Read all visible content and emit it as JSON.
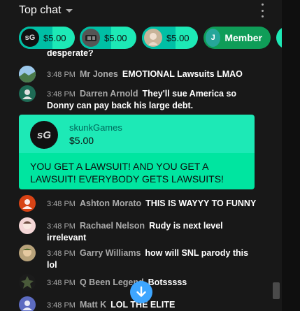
{
  "header": {
    "title": "Top chat"
  },
  "tickers": [
    {
      "amount": "$5.00",
      "avatar_text": "sG",
      "avatar_bg": "#111111",
      "fill": 0.6
    },
    {
      "amount": "$5.00",
      "avatar_text": "",
      "avatar_bg": "#555555",
      "fill": 0.55
    },
    {
      "amount": "$5.00",
      "avatar_text": "",
      "avatar_bg": "#c8b49a",
      "fill": 0.6
    },
    {
      "amount": "Member",
      "avatar_text": "J",
      "avatar_bg": "#26a69a"
    }
  ],
  "chat": {
    "partial_top": "desperate?",
    "messages": [
      {
        "time": "3:48 PM",
        "author": "Mr Jones",
        "text": "EMOTIONAL Lawsuits LMAO"
      },
      {
        "time": "3:48 PM",
        "author": "Darren Arnold",
        "text": "They'll sue America so Donny can pay back his large debt."
      },
      {
        "time": "3:48 PM",
        "author": "Ashton Morato",
        "text": "THIS IS WAYYY TO FUNNY"
      },
      {
        "time": "3:48 PM",
        "author": "Rachael Nelson",
        "text": "Rudy is next level irrelevant"
      },
      {
        "time": "3:48 PM",
        "author": "Garry Williams",
        "text": "how will SNL parody this lol"
      },
      {
        "time": "3:48 PM",
        "author": "Q Been Legend",
        "text": "Botsssss"
      },
      {
        "time": "3:48 PM",
        "author": "Matt K",
        "text": "LOL THE ELITE"
      }
    ],
    "superchat": {
      "author": "skunkGames",
      "amount": "$5.00",
      "avatar_text": "sG",
      "text": "YOU GET A LAWSUIT! AND YOU GET A LAWSUIT! EVERYBODY GETS LAWSUITS!"
    }
  },
  "icons": {
    "dropdown": "chevron-down-icon",
    "menu": "more-vert-icon",
    "jump": "arrow-down-icon"
  },
  "colors": {
    "background": "#181818",
    "superchat_header": "#1de9b6",
    "superchat_body": "#00e5a0",
    "member": "#0f9d58",
    "jump_button": "#3ea6ff"
  }
}
